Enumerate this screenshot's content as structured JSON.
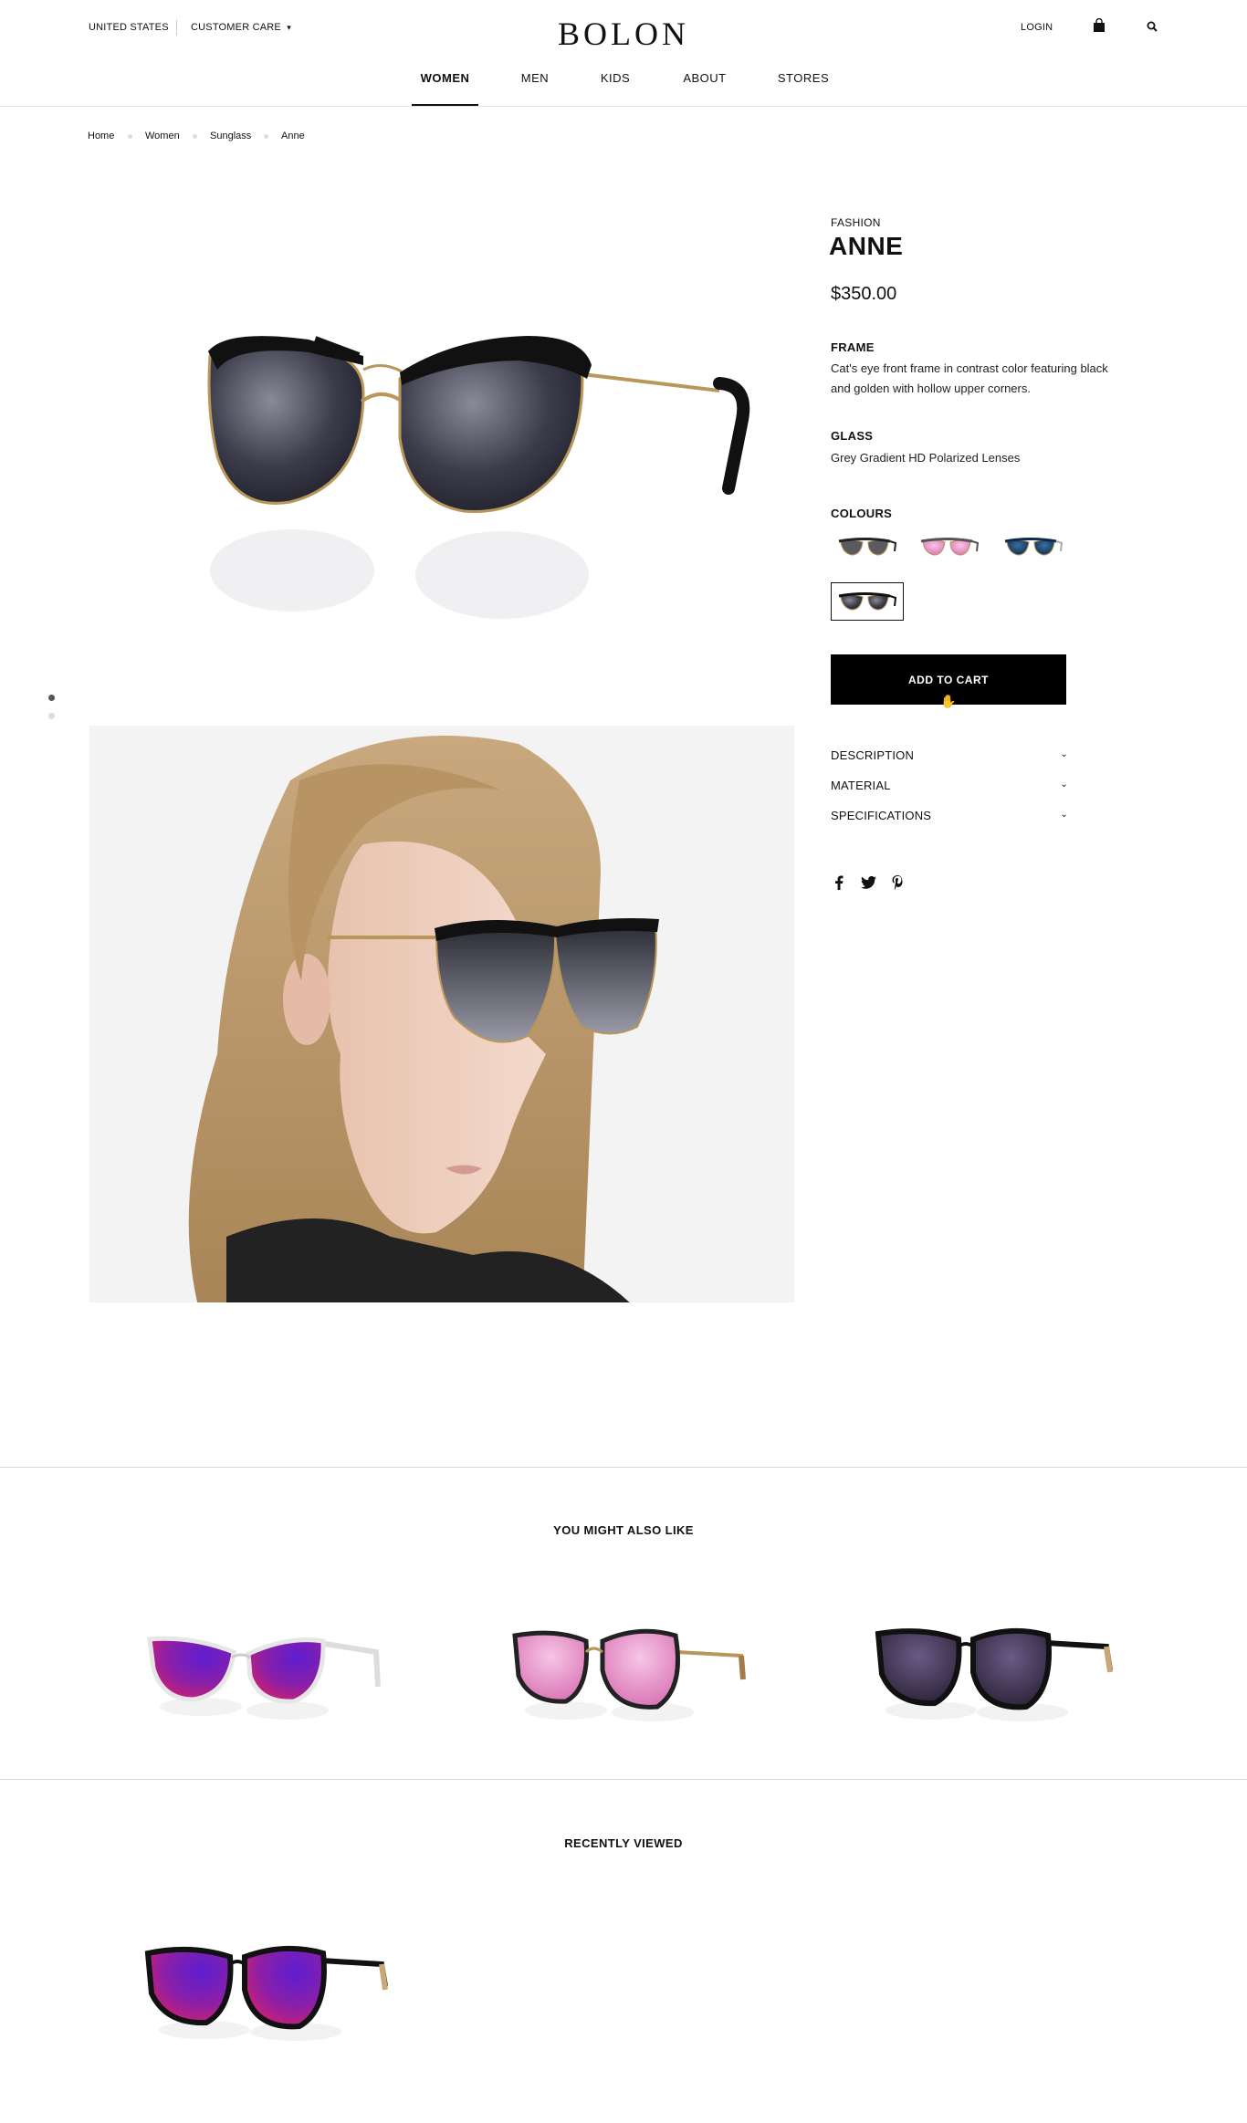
{
  "header": {
    "region": "UNITED STATES",
    "customer_care": "CUSTOMER CARE",
    "brand": "BOLON",
    "login": "LOGIN",
    "nav": [
      "WOMEN",
      "MEN",
      "KIDS",
      "ABOUT",
      "STORES"
    ]
  },
  "breadcrumb": [
    "Home",
    "Women",
    "Sunglass",
    "Anne"
  ],
  "product": {
    "category": "FASHION",
    "name": "ANNE",
    "price": "$350.00",
    "frame_heading": "FRAME",
    "frame_text": "Cat's eye front frame in contrast color featuring black and golden with hollow upper corners.",
    "glass_heading": "GLASS",
    "glass_text": "Grey Gradient HD Polarized Lenses",
    "colours_heading": "COLOURS",
    "colours": [
      "grey-gold",
      "pink",
      "blue",
      "black-grey"
    ],
    "selected_colour": "black-grey",
    "add_to_cart": "ADD TO CART",
    "accordion": [
      "DESCRIPTION",
      "MATERIAL",
      "SPECIFICATIONS"
    ]
  },
  "social": [
    "facebook-icon",
    "twitter-icon",
    "pinterest-icon"
  ],
  "sections": {
    "recommended_heading": "YOU MIGHT ALSO LIKE",
    "recently_viewed_heading": "RECENTLY VIEWED"
  },
  "colors": {
    "accent": "#000000",
    "rule": "#d8d8d8",
    "lens_purple": "#7a1fa0",
    "lens_pink": "#e79ac9",
    "lens_grey": "#3c3c4a"
  }
}
